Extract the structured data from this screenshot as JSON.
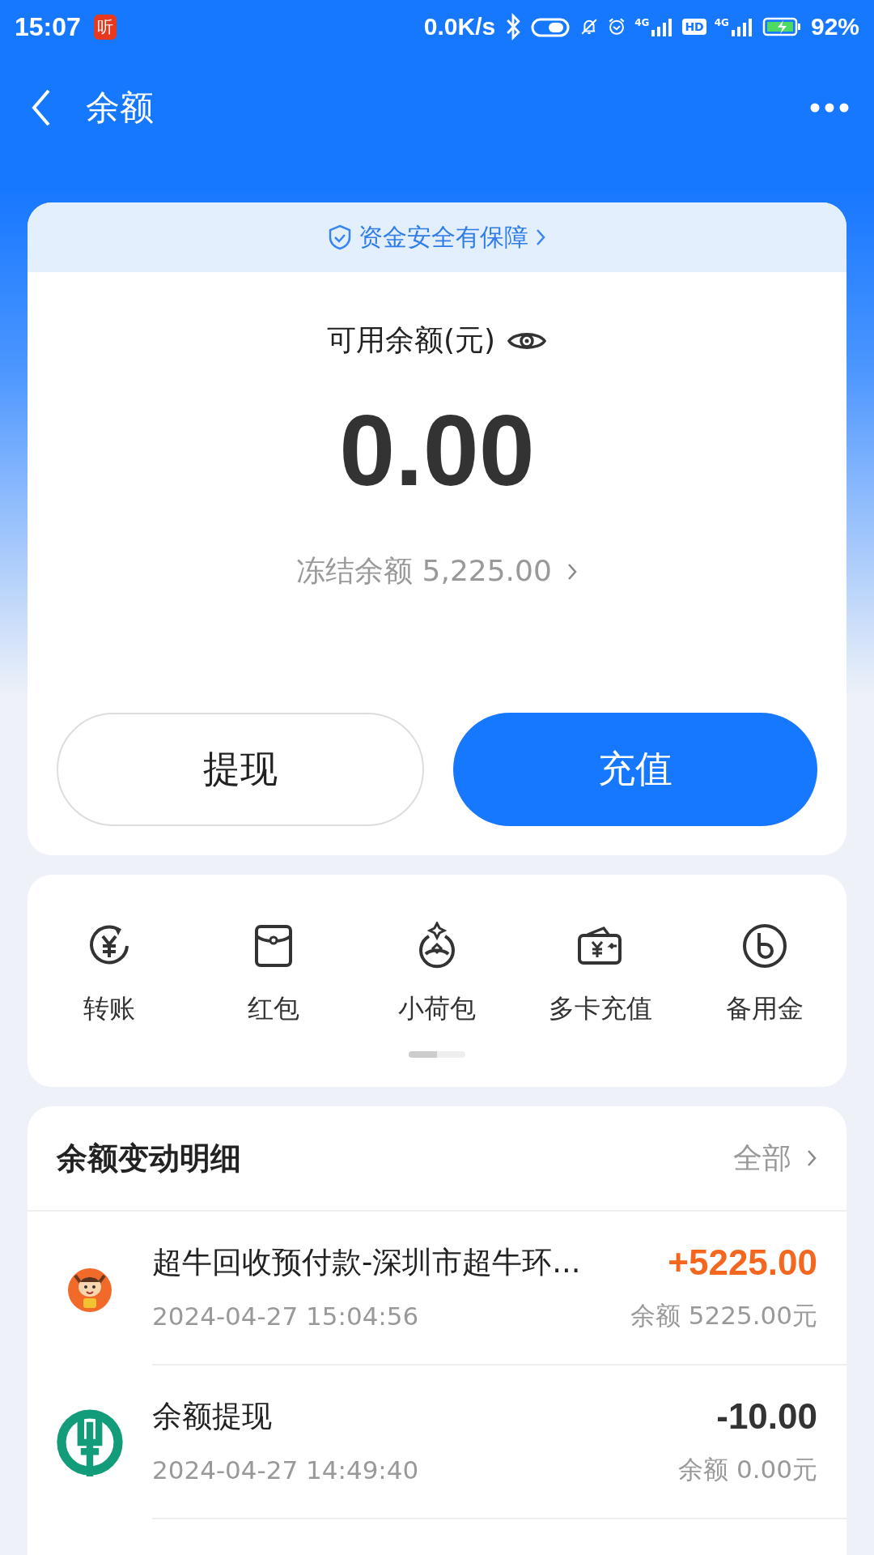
{
  "status_bar": {
    "time": "15:07",
    "app_badge": "听",
    "net_speed": "0.0K/s",
    "sim1_label": "4G",
    "hd_label": "HD",
    "sim2_label": "4G",
    "battery": "92%"
  },
  "nav": {
    "title": "余额"
  },
  "balance_card": {
    "banner": "资金安全有保障",
    "balance_label": "可用余额(元)",
    "balance": "0.00",
    "frozen_label": "冻结余额 5,225.00",
    "buttons": [
      {
        "label": "提现",
        "kind": "secondary"
      },
      {
        "label": "充值",
        "kind": "primary"
      }
    ]
  },
  "shortcuts": {
    "items": [
      {
        "label": "转账",
        "kind": "transfer"
      },
      {
        "label": "红包",
        "kind": "envelope"
      },
      {
        "label": "小荷包",
        "kind": "pouch"
      },
      {
        "label": "多卡充值",
        "kind": "wallet"
      },
      {
        "label": "备用金",
        "kind": "reserve"
      }
    ],
    "pager": {
      "level": 0.5
    }
  },
  "history": {
    "title": "余额变动明细",
    "filter": "全部",
    "rows": [
      {
        "kind": "income",
        "title": "超牛回收预付款-深圳市超牛环...",
        "time": "2024-04-27 15:04:56",
        "amount": "+5225.00",
        "balance": "余额 5225.00元"
      },
      {
        "kind": "expense",
        "title": "余额提现",
        "time": "2024-04-27 14:49:40",
        "amount": "-10.00",
        "balance": "余额 0.00元"
      }
    ]
  }
}
